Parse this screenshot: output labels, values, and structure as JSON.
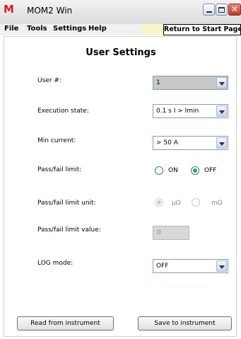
{
  "window": {
    "title": "MOM2 Win",
    "logo": "M",
    "close_glyph": "✕"
  },
  "menu": {
    "file": "File",
    "tools": "Tools",
    "settings": "Settings",
    "help": "Help",
    "return_button": "Return to Start Page"
  },
  "page": {
    "title": "User Settings"
  },
  "fields": {
    "user": {
      "label": "User #:",
      "value": "1"
    },
    "execution_state": {
      "label": "Execution state:",
      "value": "0.1 s I > Imin"
    },
    "min_current": {
      "label": "Min current:",
      "value": "> 50 A"
    },
    "pass_fail_limit": {
      "label": "Pass/fail limit:",
      "options": [
        "ON",
        "OFF"
      ],
      "selected": "OFF"
    },
    "pass_fail_limit_unit": {
      "label": "Pass/fail limit unit:",
      "options": [
        "µΩ",
        "mΩ"
      ],
      "selected": "µΩ",
      "enabled": false
    },
    "pass_fail_limit_value": {
      "label": "Pass/fail limit value:",
      "value": "0",
      "enabled": false
    },
    "log_mode": {
      "label": "LOG mode:",
      "value": "OFF"
    }
  },
  "buttons": {
    "read": "Read from instrument",
    "save": "Save to instrument"
  },
  "colors": {
    "radio_border": "#2a78c8",
    "radio_selected": "#3aa43a",
    "logo": "#e01818"
  }
}
